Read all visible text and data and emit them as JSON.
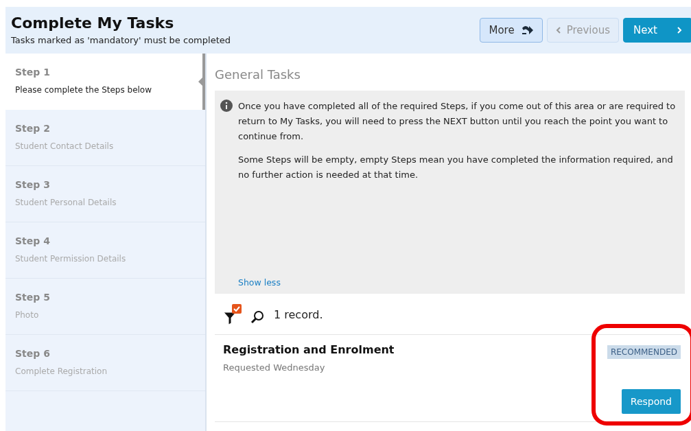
{
  "header": {
    "title": "Complete My Tasks",
    "subtitle": "Tasks marked as 'mandatory' must be completed",
    "buttons": [
      {
        "label": "More",
        "kind": "more",
        "disabled": false
      },
      {
        "label": "Previous",
        "kind": "previous",
        "disabled": true
      },
      {
        "label": "Next",
        "kind": "next",
        "disabled": false
      }
    ]
  },
  "steps": [
    {
      "label": "Step 1",
      "description": "Please complete the Steps below",
      "selected": true
    },
    {
      "label": "Step 2",
      "description": "Student Contact Details",
      "selected": false
    },
    {
      "label": "Step 3",
      "description": "Student Personal Details",
      "selected": false
    },
    {
      "label": "Step 4",
      "description": "Student Permission Details",
      "selected": false
    },
    {
      "label": "Step 5",
      "description": "Photo",
      "selected": false
    },
    {
      "label": "Step 6",
      "description": "Complete Registration",
      "selected": false
    }
  ],
  "section_title": "General Tasks",
  "info": {
    "paragraphs": [
      "Once you have completed all of the required Steps, if you come out of this area or are required to return to My Tasks, you will need to press the NEXT button until you reach the point you want to continue from.",
      "Some Steps will be empty, empty Steps mean you have completed the information required, and no further action is needed at that time."
    ],
    "toggle": "Show less"
  },
  "toolbar": {
    "filter_checked": true,
    "record_count": "1 record."
  },
  "records": [
    {
      "title": "Registration and Enrolment",
      "subtitle": "Requested Wednesday",
      "badge": "RECOMMENDED",
      "action": "Respond",
      "highlighted": true
    }
  ]
}
